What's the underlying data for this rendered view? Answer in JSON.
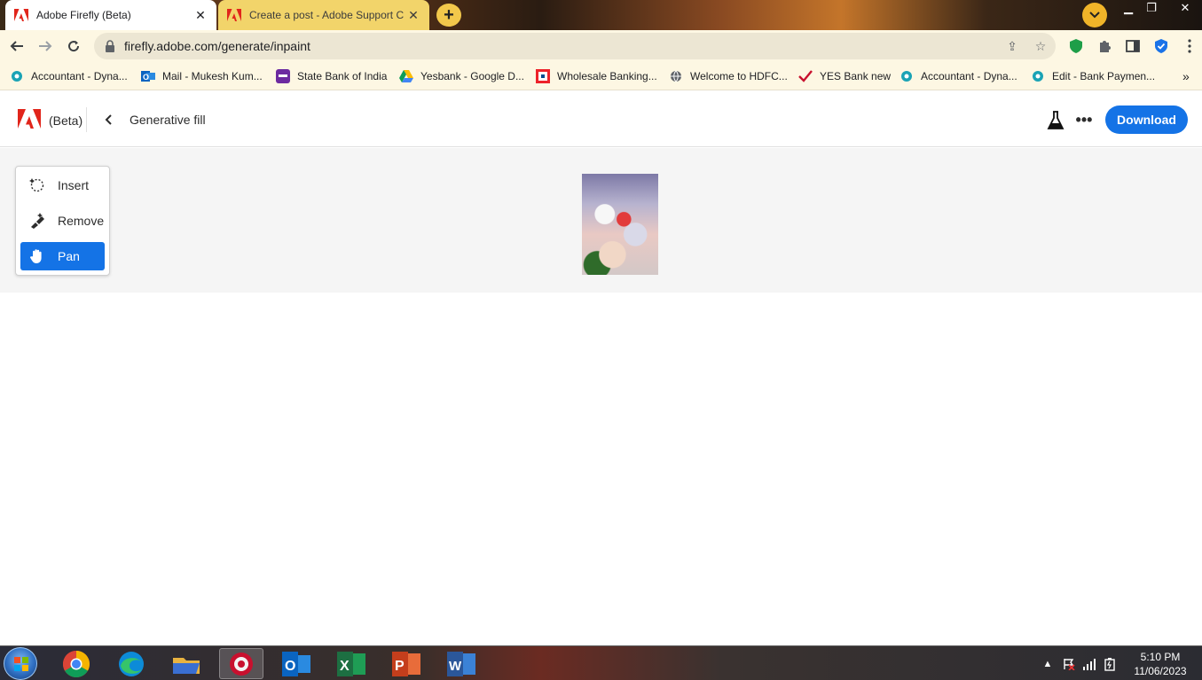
{
  "browser": {
    "tabs": [
      {
        "title": "Adobe Firefly (Beta)",
        "active": true
      },
      {
        "title": "Create a post - Adobe Support C",
        "active": false
      }
    ],
    "url": "firefly.adobe.com/generate/inpaint",
    "bookmarks": [
      {
        "label": "Accountant - Dyna...",
        "icon": "dynamics-icon"
      },
      {
        "label": "Mail - Mukesh Kum...",
        "icon": "outlook-icon"
      },
      {
        "label": "State Bank of India",
        "icon": "yono-icon"
      },
      {
        "label": "Yesbank - Google D...",
        "icon": "google-drive-icon"
      },
      {
        "label": "Wholesale Banking...",
        "icon": "hdfc-icon"
      },
      {
        "label": "Welcome to HDFC...",
        "icon": "globe-icon"
      },
      {
        "label": "YES Bank new",
        "icon": "checkmark-icon"
      },
      {
        "label": "Accountant - Dyna...",
        "icon": "dynamics-icon"
      },
      {
        "label": "Edit - Bank Paymen...",
        "icon": "dynamics-icon"
      }
    ]
  },
  "app": {
    "brand_suffix": "(Beta)",
    "page_title": "Generative fill",
    "download_label": "Download",
    "tools": [
      {
        "label": "Insert",
        "icon": "insert-brush-icon",
        "selected": false
      },
      {
        "label": "Remove",
        "icon": "remove-brush-icon",
        "selected": false
      },
      {
        "label": "Pan",
        "icon": "hand-icon",
        "selected": true
      }
    ],
    "accent_color": "#1473e6"
  },
  "taskbar": {
    "time": "5:10 PM",
    "date": "11/06/2023",
    "apps": [
      "chrome-icon",
      "edge-icon",
      "file-explorer-icon",
      "adobe-app-icon",
      "outlook-icon",
      "excel-icon",
      "powerpoint-icon",
      "word-icon"
    ]
  }
}
